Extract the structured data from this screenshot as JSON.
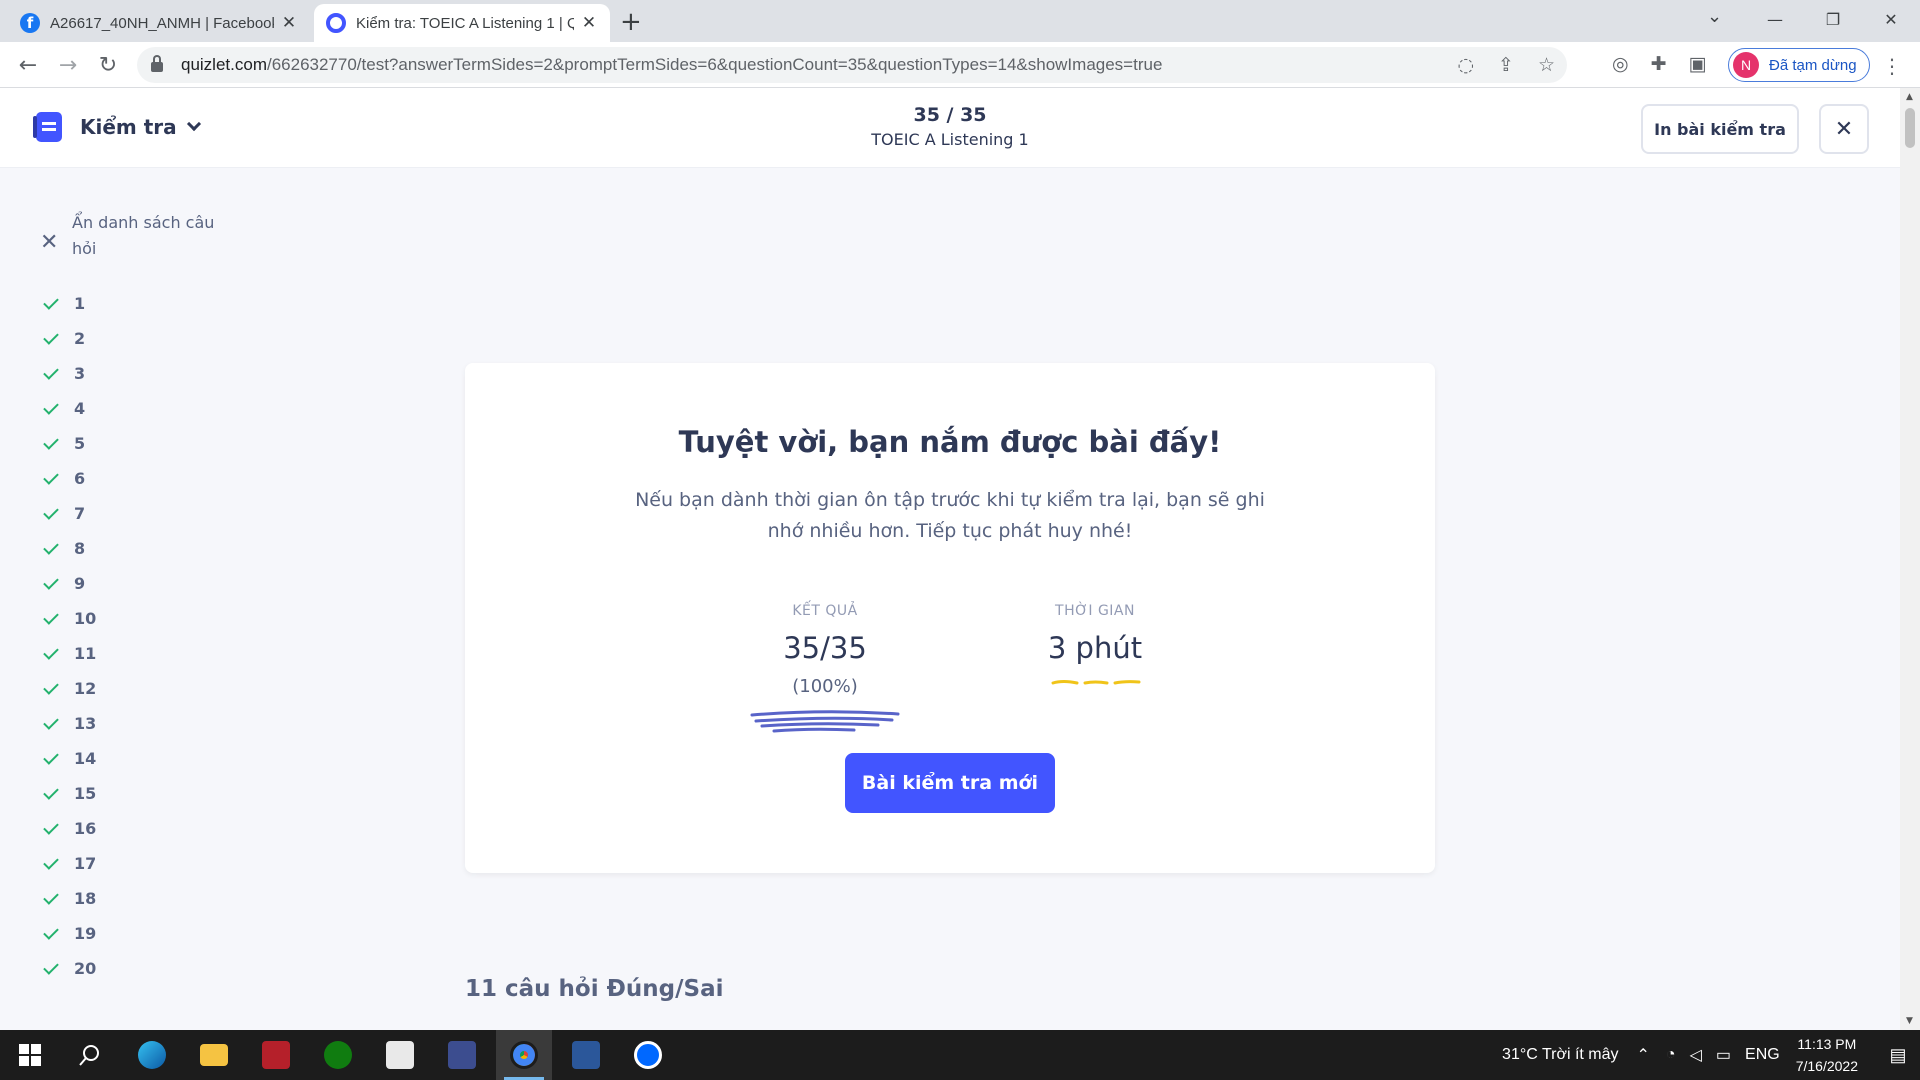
{
  "browser": {
    "tabs": [
      {
        "title": "A26617_40NH_ANMH | Facebook",
        "favicon": "facebook-icon"
      },
      {
        "title": "Kiểm tra: TOEIC A Listening 1 | Quizlet",
        "favicon": "quizlet-icon"
      }
    ],
    "url_host": "quizlet.com",
    "url_path": "/662632770/test?answerTermSides=2&promptTermSides=6&questionCount=35&questionTypes=14&showImages=true",
    "profile_initial": "N",
    "profile_label": "Đã tạm dừng"
  },
  "header": {
    "mode_label": "Kiểm tra",
    "progress": "35 / 35",
    "set_title": "TOEIC A Listening 1",
    "print_label": "In bài kiểm tra"
  },
  "sidebar": {
    "hide_label": "Ẩn danh sách câu hỏi",
    "questions": [
      "1",
      "2",
      "3",
      "4",
      "5",
      "6",
      "7",
      "8",
      "9",
      "10",
      "11",
      "12",
      "13",
      "14",
      "15",
      "16",
      "17",
      "18",
      "19",
      "20"
    ]
  },
  "result": {
    "heading": "Tuyệt vời, bạn nắm được bài đấy!",
    "message": "Nếu bạn dành thời gian ôn tập trước khi tự kiểm tra lại, bạn sẽ ghi nhớ nhiều hơn. Tiếp tục phát huy nhé!",
    "score_label": "KẾT QUẢ",
    "score_value": "35/35",
    "score_percent": "(100%)",
    "time_label": "THỜI GIAN",
    "time_value": "3 phút",
    "new_test_label": "Bài kiểm tra mới"
  },
  "next_section": "11 câu hỏi Đúng/Sai",
  "taskbar": {
    "weather": "31°C  Trời ít mây",
    "language": "ENG",
    "time": "11:13 PM",
    "date": "7/16/2022"
  },
  "colors": {
    "accent": "#4255ff",
    "success": "#23b26d",
    "text_dark": "#2e3856",
    "text_muted": "#586380"
  }
}
